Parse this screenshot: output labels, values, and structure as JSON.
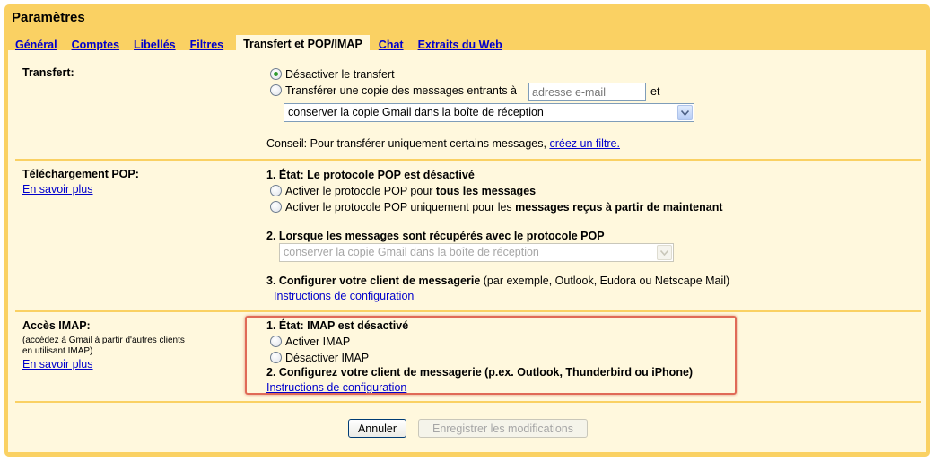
{
  "window": {
    "title": "Paramètres"
  },
  "tabs": [
    {
      "label": "Général"
    },
    {
      "label": "Comptes"
    },
    {
      "label": "Libellés"
    },
    {
      "label": "Filtres"
    },
    {
      "label": "Transfert et POP/IMAP",
      "active": true
    },
    {
      "label": "Chat"
    },
    {
      "label": "Extraits du Web"
    }
  ],
  "forwarding": {
    "label": "Transfert:",
    "option_disable": "Désactiver le transfert",
    "option_forward": "Transférer une copie des messages entrants à",
    "email_placeholder": "adresse e-mail",
    "and": "et",
    "keep_select_value": "conserver la copie Gmail dans la boîte de réception",
    "tip_text": "Conseil: Pour transférer uniquement certains messages,",
    "tip_link": "créez un filtre."
  },
  "pop": {
    "label": "Téléchargement POP:",
    "learn_more": "En savoir plus",
    "status": "1. État: Le protocole POP est désactivé",
    "option_all_prefix": "Activer le protocole POP pour",
    "option_all_bold": "tous les messages",
    "option_now_prefix": "Activer le protocole POP uniquement pour les",
    "option_now_bold": "messages reçus à partir de maintenant",
    "when_heading": "2. Lorsque les messages sont récupérés avec le protocole POP",
    "when_select_value": "conserver la copie Gmail dans la boîte de réception",
    "configure_bold": "3. Configurer votre client de messagerie",
    "configure_rest": "(par exemple, Outlook, Eudora ou Netscape Mail)",
    "instructions": "Instructions de configuration"
  },
  "imap": {
    "label": "Accès IMAP:",
    "desc_line1": "(accédez à Gmail à partir d'autres clients",
    "desc_line2": "en utilisant IMAP)",
    "learn_more": "En savoir plus",
    "status": "1. État: IMAP est désactivé",
    "option_enable": "Activer IMAP",
    "option_disable": "Désactiver IMAP",
    "configure": "2. Configurez votre client de messagerie (p.ex. Outlook, Thunderbird ou iPhone)",
    "instructions": "Instructions de configuration"
  },
  "actions": {
    "cancel": "Annuler",
    "save": "Enregistrer les modifications"
  },
  "colors": {
    "frame": "#fad163",
    "panel": "#fff8dd",
    "link": "#0000cc",
    "highlight": "#e06a57"
  }
}
